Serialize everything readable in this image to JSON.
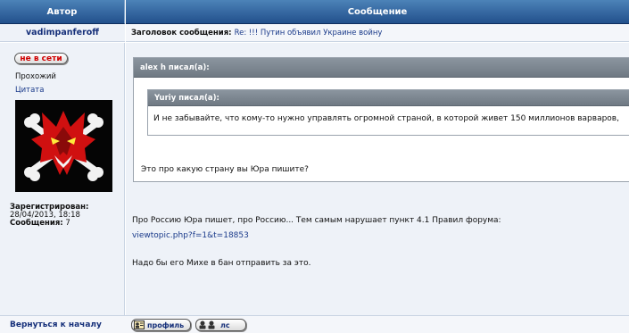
{
  "header": {
    "author_col": "Автор",
    "message_col": "Сообщение"
  },
  "post": {
    "author": "vadimpanferoff",
    "subject_label": "Заголовок сообщения:",
    "subject": "Re: !!! Путин объявил Украине войну",
    "status_button": "не в сети",
    "rank": "Прохожий",
    "quote_link": "Цитата",
    "registered_label": "Зарегистрирован:",
    "registered_date": "28/04/2013, 18:18",
    "posts_label": "Сообщения:",
    "posts_count": "7"
  },
  "quote_outer": {
    "header": "alex h писал(а):",
    "text": "Это про какую страну вы Юра пишите?"
  },
  "quote_inner": {
    "header": "Yuriy писал(а):",
    "text": "И не забывайте, что кому-то нужно управлять огромной страной, в которой живет 150 миллионов варваров,"
  },
  "body": {
    "line1": "Про Россию Юра пишет, про Россию... Тем самым нарушает пункт 4.1 Правил форума:",
    "link": "viewtopic.php?f=1&t=18853",
    "line2": "Надо бы его Михе в бан отправить за это."
  },
  "footer": {
    "back_to_top": "Вернуться к началу",
    "profile_button": "профиль",
    "pm_button": "лс"
  },
  "colors": {
    "header_bg": "#2f5f9a",
    "panel_bg": "#eef2f8",
    "quote_header": "#7a848e",
    "offline_text": "#d00000",
    "link": "#1a3a8a"
  },
  "icons": {
    "avatar": "red-wolf-jolly-roger",
    "profile_icon": "profile-card-icon",
    "pm_icon": "users-pm-icon"
  }
}
